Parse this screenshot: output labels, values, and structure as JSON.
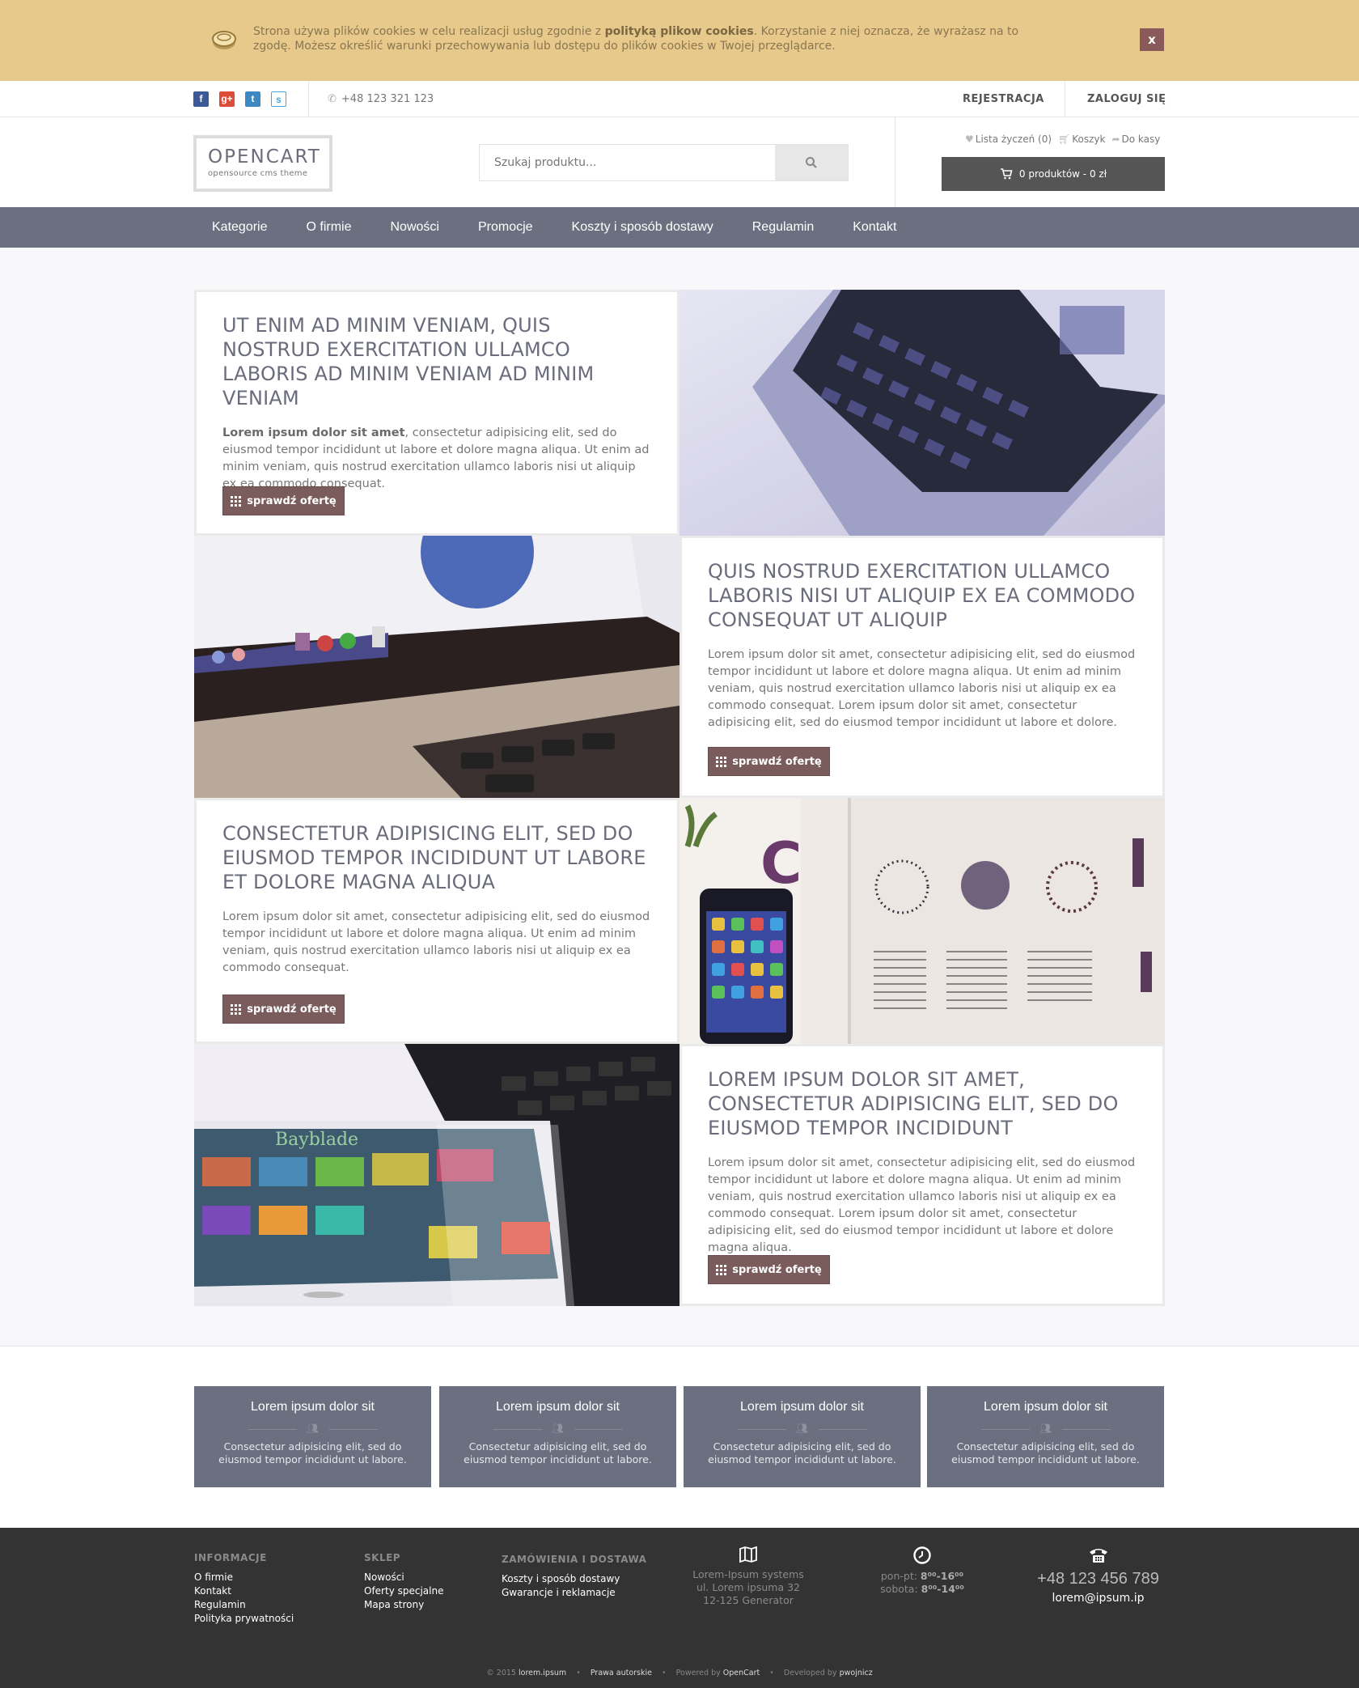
{
  "cookie": {
    "text_before": "Strona używa plików cookies w celu realizacji usług zgodnie z ",
    "link": "polityką plikow cookies",
    "text_after": ". Korzystanie z niej oznacza, że wyrażasz na to zgodę. Możesz określić warunki przechowywania lub dostępu do plików cookies w Twojej przeglądarce.",
    "close_label": "x"
  },
  "topbar": {
    "social": [
      "f",
      "g+",
      "t",
      "s"
    ],
    "phone": "+48 123 321 123",
    "register": "REJESTRACJA",
    "login": "ZALOGUJ SIĘ"
  },
  "header": {
    "logo_title": "OPENCART",
    "logo_subtitle": "opensource cms theme",
    "search_placeholder": "Szukaj produktu...",
    "wishlist": "Lista życzeń (0)",
    "cart_link": "Koszyk",
    "checkout": "Do kasy",
    "cart_summary": "0 produktów - 0 zł"
  },
  "nav": [
    "Kategorie",
    "O firmie",
    "Nowości",
    "Promocje",
    "Koszty i sposób dostawy",
    "Regulamin",
    "Kontakt"
  ],
  "tiles": [
    {
      "title": "UT ENIM AD MINIM VENIAM, QUIS NOSTRUD EXERCITATION ULLAMCO LABORIS AD MINIM VENIAM AD MINIM VENIAM",
      "lead": "Lorem ipsum dolor sit amet",
      "text": ", consectetur adipisicing elit, sed do eiusmod tempor incididunt ut labore et dolore magna aliqua. Ut enim ad minim veniam, quis nostrud exercitation ullamco laboris nisi ut aliquip ex ea commodo consequat.",
      "button": "sprawdź ofertę"
    },
    {
      "title": "QUIS NOSTRUD EXERCITATION ULLAMCO LABORIS NISI UT ALIQUIP EX EA COMMODO CONSEQUAT UT ALIQUIP",
      "text": "Lorem ipsum dolor sit amet, consectetur adipisicing elit, sed do eiusmod tempor incididunt ut labore et dolore magna aliqua. Ut enim ad minim veniam, quis nostrud exercitation ullamco laboris nisi ut aliquip ex ea commodo consequat. Lorem ipsum dolor sit amet, consectetur adipisicing elit, sed do eiusmod tempor incididunt ut labore et dolore.",
      "button": "sprawdź ofertę"
    },
    {
      "title": "CONSECTETUR ADIPISICING ELIT, SED DO EIUSMOD TEMPOR INCIDIDUNT UT LABORE ET DOLORE MAGNA ALIQUA",
      "text": "Lorem ipsum dolor sit amet, consectetur adipisicing elit, sed do eiusmod tempor incididunt ut labore et dolore magna aliqua. Ut enim ad minim veniam, quis nostrud exercitation ullamco laboris nisi ut aliquip ex ea commodo consequat.",
      "button": "sprawdź ofertę"
    },
    {
      "title": "LOREM IPSUM DOLOR SIT AMET, CONSECTETUR ADIPISICING ELIT, SED DO EIUSMOD TEMPOR INCIDIDUNT",
      "text": "Lorem ipsum dolor sit amet, consectetur adipisicing elit, sed do eiusmod tempor incididunt ut labore et dolore magna aliqua. Ut enim ad minim veniam, quis nostrud exercitation ullamco laboris nisi ut aliquip ex ea commodo consequat. Lorem ipsum dolor sit amet, consectetur adipisicing elit, sed do eiusmod tempor incididunt ut labore et dolore magna aliqua.",
      "button": "sprawdź ofertę"
    }
  ],
  "features": [
    {
      "title": "Lorem ipsum dolor sit",
      "text": "Consectetur adipisicing elit, sed do eiusmod tempor incididunt ut labore."
    },
    {
      "title": "Lorem ipsum dolor sit",
      "text": "Consectetur adipisicing elit, sed do eiusmod tempor incididunt ut labore."
    },
    {
      "title": "Lorem ipsum dolor sit",
      "text": "Consectetur adipisicing elit, sed do eiusmod tempor incididunt ut labore."
    },
    {
      "title": "Lorem ipsum dolor sit",
      "text": "Consectetur adipisicing elit, sed do eiusmod tempor incididunt ut labore."
    }
  ],
  "footer": {
    "info_title": "INFORMACJE",
    "info_links": [
      "O firmie",
      "Kontakt",
      "Regulamin",
      "Polityka prywatności"
    ],
    "shop_title": "SKLEP",
    "shop_links": [
      "Nowości",
      "Oferty specjalne",
      "Mapa strony"
    ],
    "orders_title": "ZAMÓWIENIA I DOSTAWA",
    "orders_links": [
      "Koszty i sposób dostawy",
      "Gwarancje i reklamacje"
    ],
    "address": [
      "Lorem-Ipsum systems",
      "ul. Lorem ipsuma 32",
      "12-125 Generator"
    ],
    "hours_weekday_label": "pon-pt:",
    "hours_weekday": "8⁰⁰-16⁰⁰",
    "hours_saturday_label": "sobota:",
    "hours_saturday": "8⁰⁰-14⁰⁰",
    "phone": "+48 123 456 789",
    "email": "lorem@ipsum.ip",
    "copyright_prefix": "© 2015",
    "copyright_site": "lorem.ipsum",
    "rights": "Prawa autorskie",
    "powered_prefix": "Powered by",
    "powered": "OpenCart",
    "developed_prefix": "Developed by",
    "developer": "pwojnicz"
  }
}
